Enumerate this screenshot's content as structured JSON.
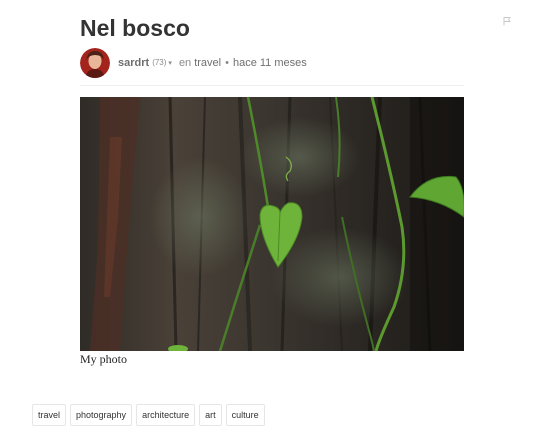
{
  "post": {
    "title": "Nel bosco",
    "author": "sardrt",
    "reputation": "(73)",
    "caret": "▾",
    "community_prefix": "en",
    "community": "travel",
    "separator": "•",
    "date": "hace 11 meses",
    "caption": "My photo"
  },
  "tags": [
    "travel",
    "photography",
    "architecture",
    "art",
    "culture"
  ],
  "icons": {
    "flag": "flag-icon",
    "avatar": "author-avatar"
  },
  "colors": {
    "title": "#333333",
    "meta": "#8a8a8a",
    "tag_border": "#e6e6e6"
  }
}
